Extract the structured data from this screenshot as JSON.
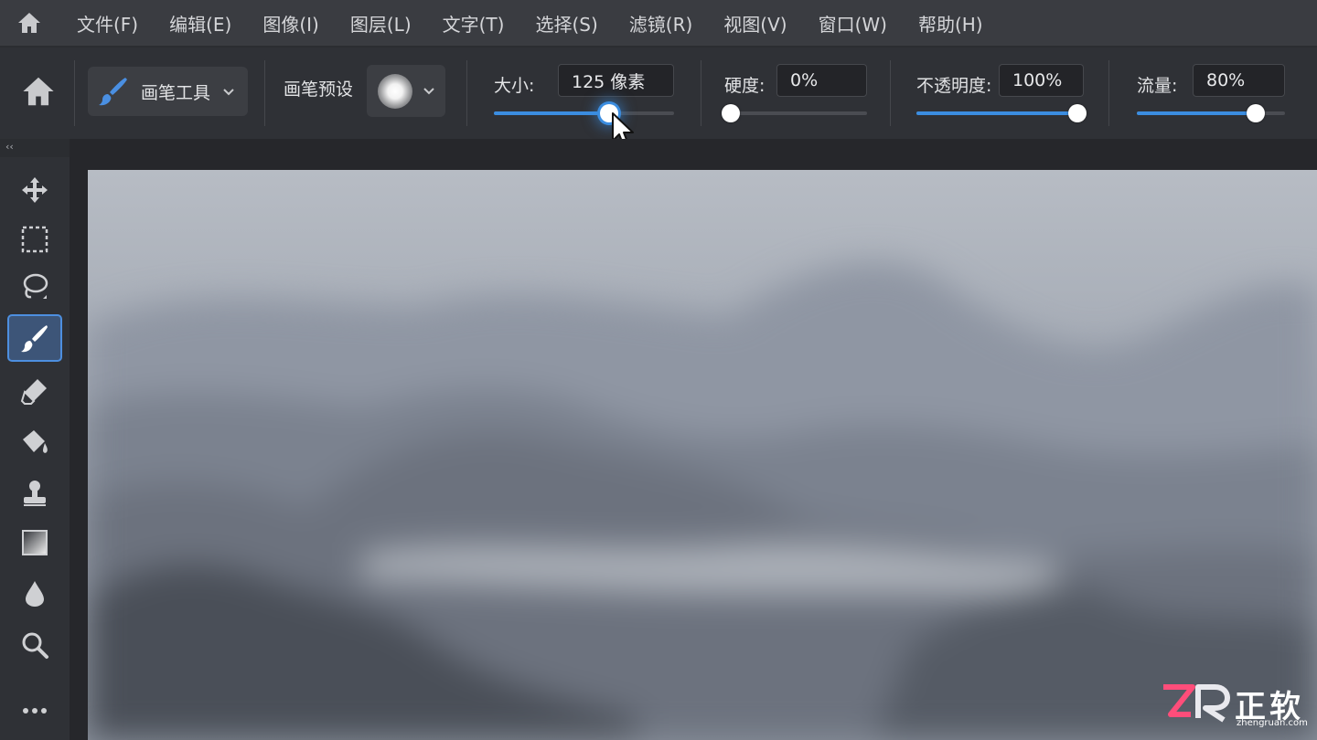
{
  "menubar": {
    "items": [
      "文件(F)",
      "编辑(E)",
      "图像(I)",
      "图层(L)",
      "文字(T)",
      "选择(S)",
      "滤镜(R)",
      "视图(V)",
      "窗口(W)",
      "帮助(H)"
    ]
  },
  "options": {
    "tool_label": "画笔工具",
    "preset_label": "画笔预设",
    "size": {
      "label": "大小:",
      "value": "125 像素",
      "level": 0.64
    },
    "hardness": {
      "label": "硬度:",
      "value": "0%",
      "level": 0.0
    },
    "opacity": {
      "label": "不透明度:",
      "value": "100%",
      "level": 1.0
    },
    "flow": {
      "label": "流量:",
      "value": "80%",
      "level": 0.8
    }
  },
  "toolbar": {
    "tools": [
      "move-icon",
      "marquee-icon",
      "lasso-icon",
      "brush-icon",
      "eraser-icon",
      "paint-bucket-icon",
      "stamp-icon",
      "gradient-icon",
      "blur-drop-icon",
      "zoom-icon",
      "more-icon"
    ],
    "selected": "brush-icon"
  },
  "colors": {
    "accent": "#3b8de0",
    "menubar": "#3a3c41",
    "panel": "#2f3136"
  },
  "watermark": {
    "brand": "正软",
    "url": "zhengruan.com"
  }
}
